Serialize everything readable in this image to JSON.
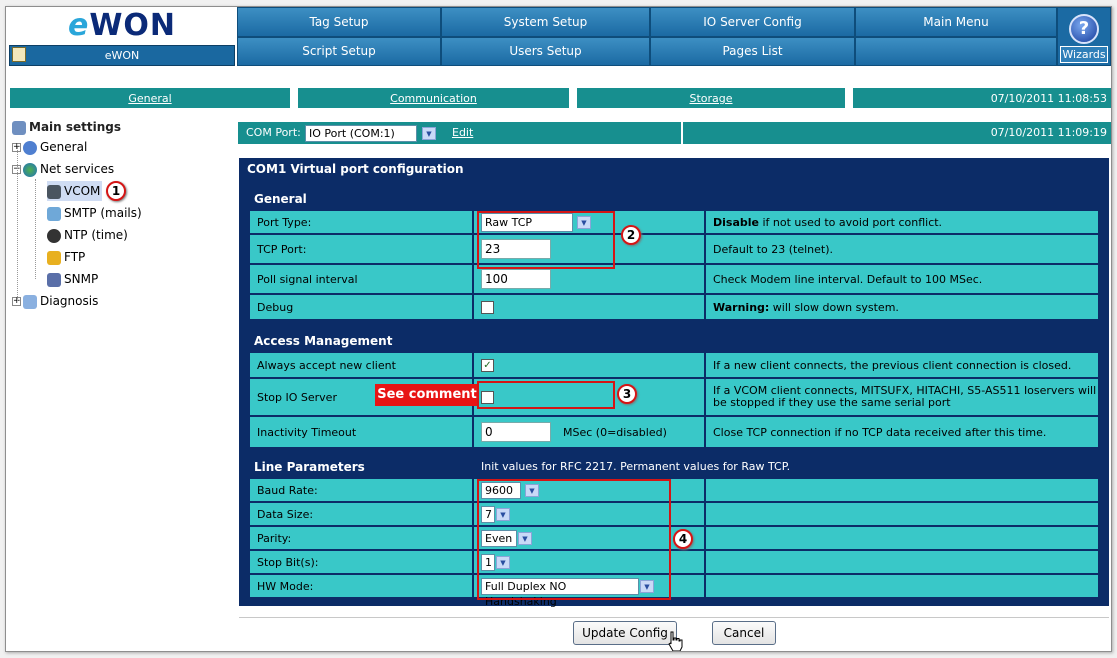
{
  "logo": {
    "text_a": "e",
    "text_b": "WON"
  },
  "home": {
    "label": "eWON"
  },
  "menu": {
    "row1": [
      "Tag Setup",
      "System Setup",
      "IO Server Config",
      "Main Menu"
    ],
    "row2": [
      "Script Setup",
      "Users Setup",
      "Pages List",
      ""
    ],
    "wizards": "Wizards",
    "help_glyph": "?"
  },
  "subnav": {
    "general": "General",
    "communication": "Communication",
    "storage": "Storage",
    "datetime": "07/10/2011 11:08:53"
  },
  "tree": {
    "root": "Main settings",
    "general": "General",
    "net_services": "Net services",
    "children": [
      "VCOM",
      "SMTP (mails)",
      "NTP (time)",
      "FTP",
      "SNMP"
    ],
    "diagnosis": "Diagnosis",
    "vcom_callout": "1"
  },
  "combar": {
    "label": "COM Port:",
    "value": "IO Port (COM:1)",
    "edit": "Edit",
    "datetime": "07/10/2011 11:09:19"
  },
  "panel": {
    "title": "COM1 Virtual port configuration",
    "general": {
      "heading": "General",
      "port_type_label": "Port Type:",
      "port_type_value": "Raw TCP",
      "port_type_hint_bold": "Disable",
      "port_type_hint": " if not used to avoid port conflict.",
      "tcp_port_label": "TCP Port:",
      "tcp_port_value": "23",
      "tcp_port_hint": "Default to 23 (telnet).",
      "poll_label": "Poll signal interval",
      "poll_value": "100",
      "poll_hint": "Check Modem line interval. Default to 100 MSec.",
      "debug_label": "Debug",
      "debug_hint_bold": "Warning:",
      "debug_hint": " will slow down system.",
      "callout": "2"
    },
    "access": {
      "heading": "Access Management",
      "always_label": "Always accept new client",
      "always_check": "✓",
      "always_hint": "If a new client connects, the previous client connection is closed.",
      "stop_label": "Stop IO Server",
      "see_comment": "See comment",
      "stop_hint": "If a VCOM client connects, MITSUFX, HITACHI, S5-AS511 Ioservers will be stopped if they use the same serial port",
      "timeout_label": "Inactivity Timeout",
      "timeout_value": "0",
      "timeout_unit": "MSec (0=disabled)",
      "timeout_hint": "Close TCP connection if no TCP data received after this time.",
      "callout": "3"
    },
    "line": {
      "heading": "Line Parameters",
      "note": "Init values for RFC 2217. Permanent values for Raw TCP.",
      "baud_label": "Baud Rate:",
      "baud_value": "9600",
      "data_label": "Data Size:",
      "data_value": "7",
      "parity_label": "Parity:",
      "parity_value": "Even",
      "stop_label": "Stop Bit(s):",
      "stop_value": "1",
      "hw_label": "HW Mode:",
      "hw_value": "Full Duplex NO Handshaking",
      "callout": "4"
    }
  },
  "buttons": {
    "update": "Update Config",
    "cancel": "Cancel"
  },
  "colors": {
    "teal": "#39c8c8",
    "navy": "#0c2c67",
    "menu_blue": "#1b6aa3",
    "callout_red": "#d51515"
  }
}
